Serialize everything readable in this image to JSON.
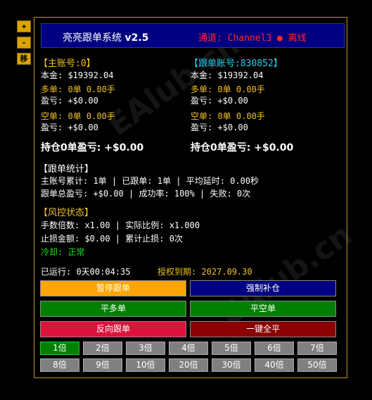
{
  "side_controls": {
    "plus": "+",
    "minus": "-",
    "move": "移"
  },
  "header": {
    "title_prefix": "亮亮跟单系统",
    "version": "v2.5",
    "channel": "通道: Channel3",
    "status_dot": "●",
    "status": "离线",
    "status_color": "#ff2a2a"
  },
  "main_account": {
    "label": "【主账号:0】",
    "capital": "本金: $19392.04",
    "long": "多单: 0单 0.00手",
    "long_pnl": "盈亏: +$0.00",
    "short": "空单: 0单 0.00手",
    "short_pnl": "盈亏: +$0.00",
    "position_label": "持仓0单盈亏:",
    "position_value": "+$0.00"
  },
  "follow_account": {
    "label": "【跟单账号:830852】",
    "capital": "本金: $19392.04",
    "long": "多单: 0单 0.00手",
    "long_pnl": "盈亏: +$0.00",
    "short": "空单: 0单 0.00手",
    "short_pnl": "盈亏: +$0.00",
    "position_label": "持仓0单盈亏:",
    "position_value": "+$0.00"
  },
  "stats": {
    "title": "【跟单统计】",
    "line1": "主账号累计: 1单  |  已跟单: 1单  | 平均延时: 0.00秒",
    "line2": "跟单总盈亏: +$0.00 | 成功率: 100% |  失败: 0次"
  },
  "risk": {
    "title": "【风控状态】",
    "line1": "手数倍数: x1.00  |  实际比例: x1.000",
    "line2": "止损金额: $0.00   |  累计止损: 0次",
    "cooldown": "冷却: 正常"
  },
  "runtime": "已运行: 0天00:04:35",
  "license": "授权到期: 2027.09.30",
  "buttons": {
    "pause": "暂停跟单",
    "force": "强制补仓",
    "close_long": "平多单",
    "close_short": "平空单",
    "reverse": "反向跟单",
    "close_all": "一键全平"
  },
  "colors": {
    "pause": "#ffa500",
    "force": "#000080",
    "close_long": "#008000",
    "close_short": "#008000",
    "reverse": "#dc143c",
    "close_all": "#8b0000"
  },
  "multipliers": [
    "1倍",
    "2倍",
    "3倍",
    "4倍",
    "5倍",
    "6倍",
    "7倍",
    "8倍",
    "9倍",
    "10倍",
    "20倍",
    "30倍",
    "40倍",
    "50倍"
  ],
  "active_multiplier": "1倍",
  "watermark": "EAlub.cn"
}
